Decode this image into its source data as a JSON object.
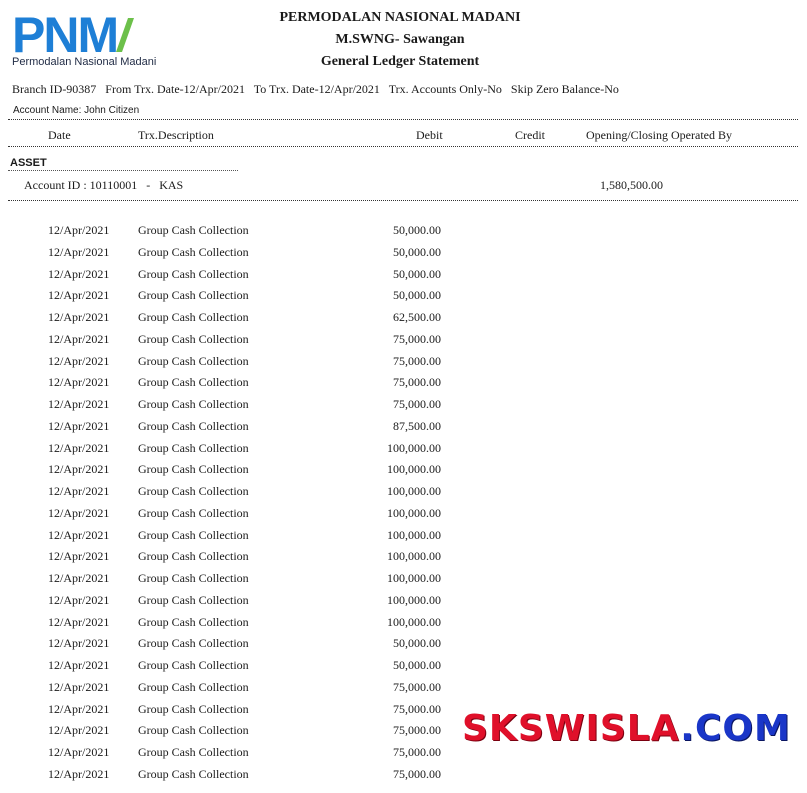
{
  "logo": {
    "text": "PNM",
    "subtitle": "Permodalan Nasional Madani"
  },
  "header": {
    "company": "PERMODALAN NASIONAL MADANI",
    "branch_name": "M.SWNG- Sawangan",
    "report_title": "General Ledger Statement"
  },
  "params": {
    "line": "Branch ID-90387   From Trx. Date-12/Apr/2021   To Trx. Date-12/Apr/2021   Trx. Accounts Only-No   Skip Zero Balance-No"
  },
  "account_name": "Account Name: John Citizen",
  "columns": {
    "date": "Date",
    "description": "Trx.Description",
    "debit": "Debit",
    "credit": "Credit",
    "opening_closing": "Opening/Closing Operated By"
  },
  "section": "ASSET",
  "account": {
    "id_line": "Account ID : 10110001   -   KAS",
    "opening_balance": "1,580,500.00"
  },
  "rows": [
    {
      "date": "12/Apr/2021",
      "desc": "Group Cash Collection",
      "debit": "50,000.00"
    },
    {
      "date": "12/Apr/2021",
      "desc": "Group Cash Collection",
      "debit": "50,000.00"
    },
    {
      "date": "12/Apr/2021",
      "desc": "Group Cash Collection",
      "debit": "50,000.00"
    },
    {
      "date": "12/Apr/2021",
      "desc": "Group Cash Collection",
      "debit": "50,000.00"
    },
    {
      "date": "12/Apr/2021",
      "desc": "Group Cash Collection",
      "debit": "62,500.00"
    },
    {
      "date": "12/Apr/2021",
      "desc": "Group Cash Collection",
      "debit": "75,000.00"
    },
    {
      "date": "12/Apr/2021",
      "desc": "Group Cash Collection",
      "debit": "75,000.00"
    },
    {
      "date": "12/Apr/2021",
      "desc": "Group Cash Collection",
      "debit": "75,000.00"
    },
    {
      "date": "12/Apr/2021",
      "desc": "Group Cash Collection",
      "debit": "75,000.00"
    },
    {
      "date": "12/Apr/2021",
      "desc": "Group Cash Collection",
      "debit": "87,500.00"
    },
    {
      "date": "12/Apr/2021",
      "desc": "Group Cash Collection",
      "debit": "100,000.00"
    },
    {
      "date": "12/Apr/2021",
      "desc": "Group Cash Collection",
      "debit": "100,000.00"
    },
    {
      "date": "12/Apr/2021",
      "desc": "Group Cash Collection",
      "debit": "100,000.00"
    },
    {
      "date": "12/Apr/2021",
      "desc": "Group Cash Collection",
      "debit": "100,000.00"
    },
    {
      "date": "12/Apr/2021",
      "desc": "Group Cash Collection",
      "debit": "100,000.00"
    },
    {
      "date": "12/Apr/2021",
      "desc": "Group Cash Collection",
      "debit": "100,000.00"
    },
    {
      "date": "12/Apr/2021",
      "desc": "Group Cash Collection",
      "debit": "100,000.00"
    },
    {
      "date": "12/Apr/2021",
      "desc": "Group Cash Collection",
      "debit": "100,000.00"
    },
    {
      "date": "12/Apr/2021",
      "desc": "Group Cash Collection",
      "debit": "100,000.00"
    },
    {
      "date": "12/Apr/2021",
      "desc": "Group Cash Collection",
      "debit": "50,000.00"
    },
    {
      "date": "12/Apr/2021",
      "desc": "Group Cash Collection",
      "debit": "50,000.00"
    },
    {
      "date": "12/Apr/2021",
      "desc": "Group Cash Collection",
      "debit": "75,000.00"
    },
    {
      "date": "12/Apr/2021",
      "desc": "Group Cash Collection",
      "debit": "75,000.00"
    },
    {
      "date": "12/Apr/2021",
      "desc": "Group Cash Collection",
      "debit": "75,000.00"
    },
    {
      "date": "12/Apr/2021",
      "desc": "Group Cash Collection",
      "debit": "75,000.00"
    },
    {
      "date": "12/Apr/2021",
      "desc": "Group Cash Collection",
      "debit": "75,000.00"
    }
  ],
  "watermark": {
    "part1": "SKSWISLA",
    "part2": ".COM"
  },
  "colors": {
    "logo_blue": "#1e7fd6",
    "logo_green": "#6cc04a",
    "watermark_red": "#e0102a",
    "watermark_blue": "#1a36c8"
  }
}
